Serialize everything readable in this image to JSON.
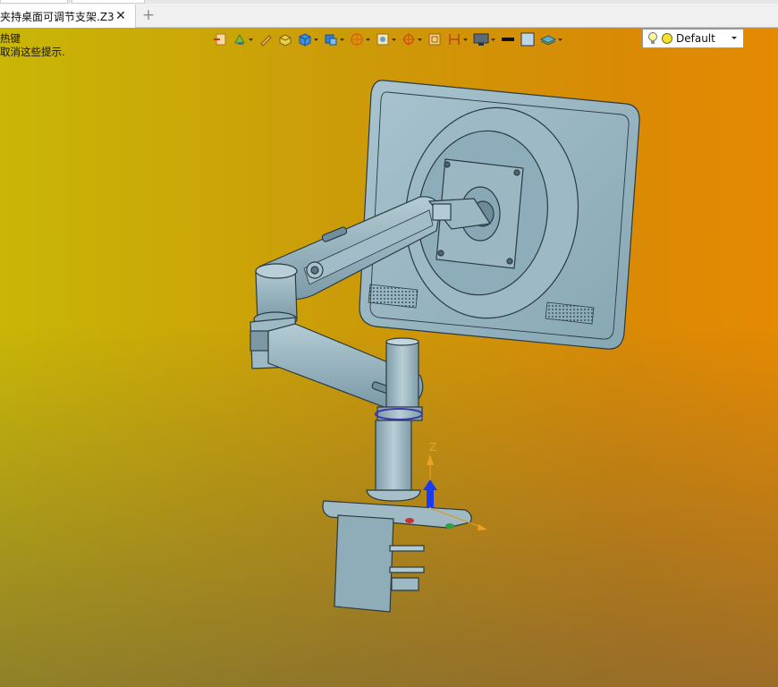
{
  "tabs": [
    {
      "title": "夹持桌面可调节支架.Z3",
      "close_glyph": "✕"
    }
  ],
  "new_tab_glyph": "+",
  "hint_lines": [
    "热键",
    "取消这些提示."
  ],
  "toolbar": {
    "icons": [
      "exit-sketch-icon",
      "paint-icon",
      "pencil-icon",
      "color-box-icon",
      "shaded-cube-icon",
      "view-cube-icon",
      "render-mode-icon",
      "filter-icon",
      "snap-icon",
      "frame-icon",
      "dimension-icon",
      "display-icon",
      "line-color-icon",
      "fill-color-icon",
      "layer-icon"
    ],
    "style_selector": {
      "value": "Default",
      "icons": [
        "lightbulb-icon",
        "yellow-dot-icon"
      ]
    }
  },
  "triad": {
    "z_label": "Z"
  },
  "colors": {
    "model": "#8fb0bd",
    "model_shade": "#6f8f9c",
    "triad_z": "#f0a020",
    "triad_arrow": "#1a3cf0"
  }
}
